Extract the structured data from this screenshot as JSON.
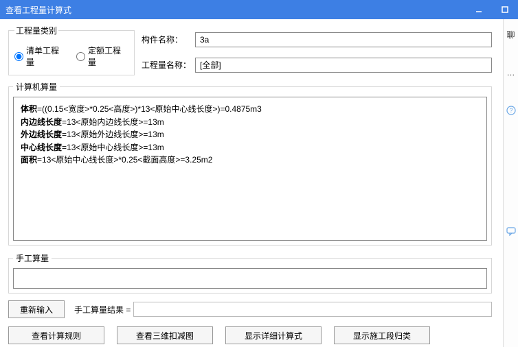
{
  "title": "查看工程量计算式",
  "quantity_type": {
    "legend": "工程量类别",
    "opt_list": "清单工程量",
    "opt_quota": "定额工程量",
    "selected": "list"
  },
  "labels": {
    "component_name": "构件名称：",
    "quantity_name": "工程量名称："
  },
  "fields": {
    "component_name": "3a",
    "quantity_name": "[全部]"
  },
  "computer": {
    "legend": "计算机算量",
    "lines": [
      {
        "label": "体积",
        "expr": "=((0.15<宽度>*0.25<高度>)*13<原始中心线长度>)=0.4875m3"
      },
      {
        "label": "内边线长度",
        "expr": "=13<原始内边线长度>=13m"
      },
      {
        "label": "外边线长度",
        "expr": "=13<原始外边线长度>=13m"
      },
      {
        "label": "中心线长度",
        "expr": "=13<原始中心线长度>=13m"
      },
      {
        "label": "面积",
        "expr": "=13<原始中心线长度>*0.25<截面高度>=3.25m2"
      }
    ]
  },
  "manual": {
    "legend": "手工算量",
    "value": "",
    "result_label": "手工算量结果 =",
    "result_value": ""
  },
  "buttons": {
    "reset": "重新输入",
    "view_rules": "查看计算规则",
    "view_deduct": "查看三维扣减图",
    "show_detail": "显示详细计算式",
    "show_segment": "显示施工段归类"
  },
  "side": {
    "char1": "聊",
    "char2": "…"
  }
}
